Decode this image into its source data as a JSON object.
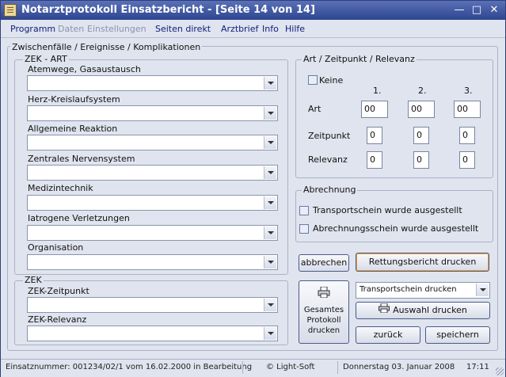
{
  "window": {
    "title": "Notarztprotokoll Einsatzbericht - [Seite 14 von 14]"
  },
  "menu": {
    "programm": "Programm",
    "daten": "Daten",
    "einstellungen": "Einstellungen",
    "seiten_direkt": "Seiten direkt",
    "arztbrief": "Arztbrief",
    "info": "Info",
    "hilfe": "Hilfe"
  },
  "zwischenfaelle": {
    "label": "Zwischenfälle / Ereignisse / Komplikationen",
    "zek_art": {
      "label": "ZEK - ART",
      "fields": [
        {
          "label": "Atemwege, Gasaustausch",
          "value": ""
        },
        {
          "label": "Herz-Kreislaufsystem",
          "value": ""
        },
        {
          "label": "Allgemeine Reaktion",
          "value": ""
        },
        {
          "label": "Zentrales Nervensystem",
          "value": ""
        },
        {
          "label": "Medizintechnik",
          "value": ""
        },
        {
          "label": "Iatrogene Verletzungen",
          "value": ""
        },
        {
          "label": "Organisation",
          "value": ""
        }
      ]
    },
    "zek": {
      "label": "ZEK",
      "fields": [
        {
          "label": "ZEK-Zeitpunkt",
          "value": ""
        },
        {
          "label": "ZEK-Relevanz",
          "value": ""
        }
      ]
    }
  },
  "art_zeit": {
    "label": "Art / Zeitpunkt / Relevanz",
    "keine": "Keine",
    "cols": [
      "1.",
      "2.",
      "3."
    ],
    "rows": [
      {
        "label": "Art",
        "values": [
          "00",
          "00",
          "00"
        ]
      },
      {
        "label": "Zeitpunkt",
        "values": [
          "0",
          "0",
          "0"
        ]
      },
      {
        "label": "Relevanz",
        "values": [
          "0",
          "0",
          "0"
        ]
      }
    ]
  },
  "abrechnung": {
    "label": "Abrechnung",
    "transportschein": "Transportschein wurde ausgestellt",
    "abrechnungsschein": "Abrechnungsschein wurde ausgestellt"
  },
  "buttons": {
    "abbrechen": "abbrechen",
    "rettungsbericht": "Rettungsbericht drucken",
    "gesamtes": [
      "Gesamtes",
      "Protokoll",
      "drucken"
    ],
    "druck_select": "Transportschein drucken",
    "auswahl": "Auswahl drucken",
    "zurueck": "zurück",
    "speichern": "speichern"
  },
  "status": {
    "einsatz": "Einsatznummer: 001234/02/1 vom 16.02.2000 in Bearbeitung",
    "copyright": "© Light-Soft",
    "datum": "Donnerstag  03. Januar  2008",
    "zeit": "17:11"
  },
  "colors": {
    "titlebar": "#2e4590",
    "background": "#dfe4ee",
    "menu_text": "#102080"
  }
}
